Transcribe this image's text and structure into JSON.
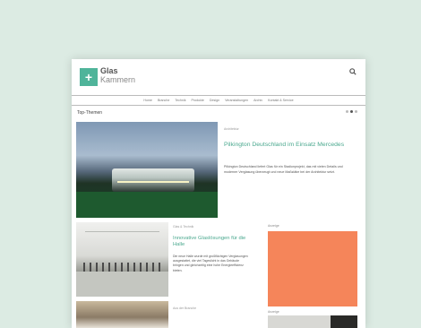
{
  "header": {
    "logo_line1": "Glas",
    "logo_line2": "Kammern",
    "logo_glyph": "+"
  },
  "nav": {
    "items": [
      "Home",
      "Branche",
      "Technik",
      "Produkte",
      "Design",
      "Veranstaltungen",
      "Archiv",
      "Kontakt & Service"
    ]
  },
  "section": {
    "title": "Top-Themen"
  },
  "hero": {
    "category": "Architektur",
    "title": "Pilkington Deutschland im Einsatz Mercedes",
    "text": "Pilkington Deutschland liefert Glas für ein Stadionprojekt, das mit vielen Details und moderner Verglasung überzeugt und neue Maßstäbe bei der Architektur setzt."
  },
  "card2": {
    "category": "Glas & Technik",
    "title": "Innovative Glaslösungen für die Halle",
    "text": "Die neue Halle wurde mit großflächigen Verglasungen ausgestattet, die viel Tageslicht in das Gebäude bringen und gleichzeitig eine hohe Energieeffizienz bieten."
  },
  "card3": {
    "category": "Aus der Branche"
  },
  "sidebar": {
    "label_top": "Anzeige",
    "label_bottom": "Anzeige",
    "ad_color": "#f5855a"
  },
  "colors": {
    "accent": "#4fb49a",
    "background": "#dcebe3"
  }
}
